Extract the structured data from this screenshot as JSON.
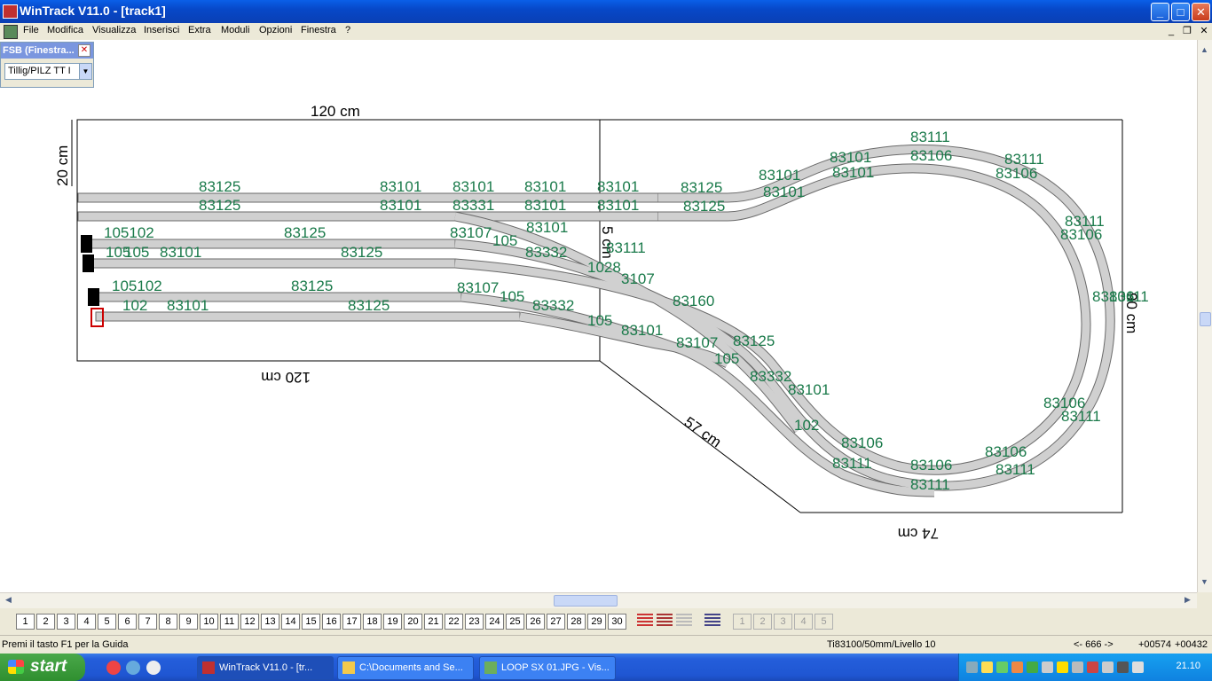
{
  "window": {
    "title": "WinTrack  V11.0 - [track1]",
    "minimize": "_",
    "maximize": "□",
    "close": "✕"
  },
  "menu": [
    "File",
    "Modifica",
    "Visualizza",
    "Inserisci",
    "Extra",
    "Moduli",
    "Opzioni",
    "Finestra",
    "?"
  ],
  "fsb": {
    "title": "FSB (Finestra...",
    "selected": "Tillig/PILZ  TT I"
  },
  "dimensions": {
    "top": "120 cm",
    "bottom": "120 cm",
    "left": "20 cm",
    "right": "90 cm",
    "diagonal": "57 cm",
    "bottom_right": "74 cm",
    "middle": "5 cm"
  },
  "track_labels": {
    "row1": [
      "83125",
      "83101",
      "83101",
      "83101",
      "83101",
      "83125"
    ],
    "row2": [
      "83125",
      "83101",
      "83331",
      "83101",
      "83101",
      "83125"
    ],
    "row3": [
      "105102",
      "83125",
      "83107",
      "105",
      "83101"
    ],
    "row4": [
      "105",
      "105",
      "83101",
      "83125",
      "83332"
    ],
    "row5": [
      "105102",
      "83125",
      "83107",
      "105"
    ],
    "row6": [
      "102",
      "83101",
      "83125",
      "83332",
      "105",
      "83101"
    ],
    "loop": [
      "83101",
      "83101",
      "83101",
      "83101",
      "83111",
      "83106",
      "83111",
      "83106",
      "83111",
      "83106",
      "83106",
      "83111",
      "83106",
      "83111",
      "83106",
      "83111",
      "83106",
      "83111",
      "83106",
      "83111"
    ],
    "diag": [
      "83111",
      "1028",
      "3107",
      "83160",
      "83125",
      "83101",
      "83332",
      "102",
      "83107",
      "105",
      "83106",
      "83111"
    ]
  },
  "toolbar": {
    "levels": [
      "1",
      "2",
      "3",
      "4",
      "5",
      "6",
      "7",
      "8",
      "9",
      "10",
      "11",
      "12",
      "13",
      "14",
      "15",
      "16",
      "17",
      "18",
      "19",
      "20",
      "21",
      "22",
      "23",
      "24",
      "25",
      "26",
      "27",
      "28",
      "29",
      "30"
    ],
    "gray_levels": [
      "1",
      "2",
      "3",
      "4",
      "5"
    ]
  },
  "statusbar": {
    "help": "Premi il tasto F1 per la Guida",
    "track_info": "Ti83100/50mm/Livello 10",
    "range": "<- 666 ->",
    "x": "+00574",
    "y": "+00432"
  },
  "taskbar": {
    "start": "start",
    "tasks": [
      "WinTrack  V11.0 - [tr...",
      "C:\\Documents and Se...",
      "LOOP SX 01.JPG - Vis..."
    ],
    "clock": "21.10"
  },
  "colors": {
    "label_green": "#1a7a4a",
    "rail_gray": "#d0d0d0",
    "title_blue": "#0a5fe8"
  }
}
